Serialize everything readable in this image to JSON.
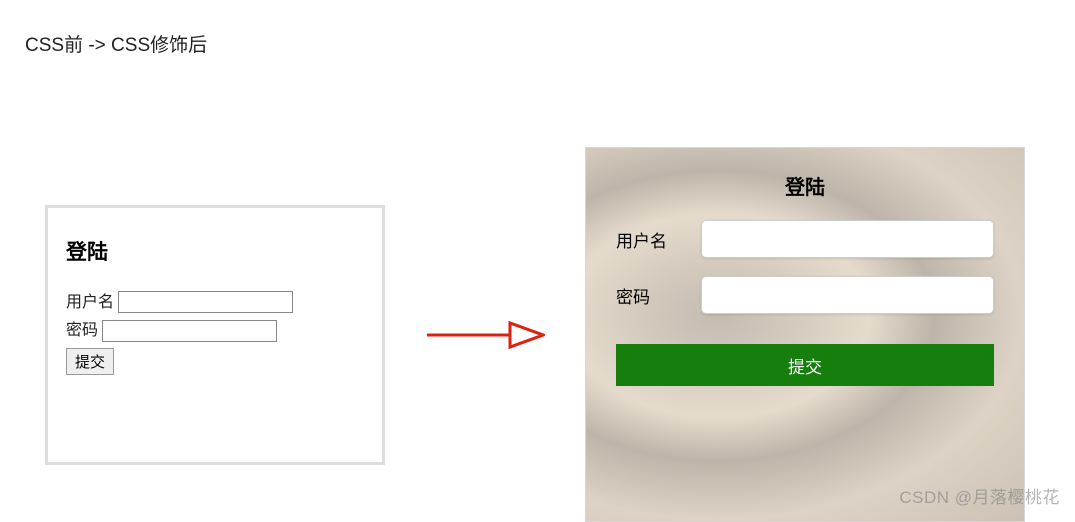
{
  "title": "CSS前 -> CSS修饰后",
  "before": {
    "heading": "登陆",
    "username_label": "用户名",
    "password_label": "密码",
    "submit_label": "提交"
  },
  "after": {
    "heading": "登陆",
    "username_label": "用户名",
    "password_label": "密码",
    "submit_label": "提交"
  },
  "watermark": "CSDN @月落樱桃花"
}
